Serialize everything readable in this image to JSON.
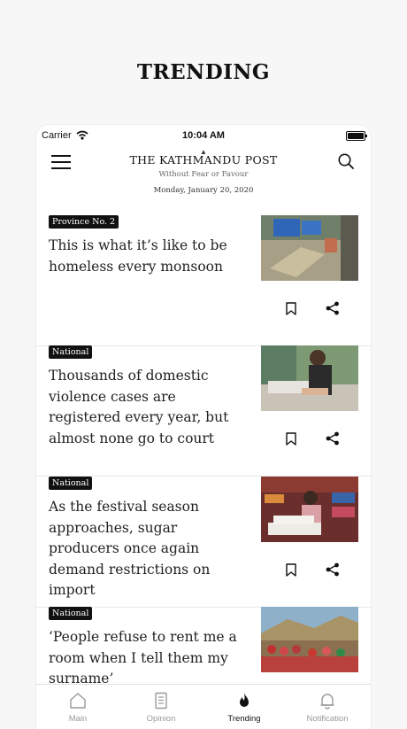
{
  "banner": {
    "title": "TRENDING"
  },
  "status_bar": {
    "carrier": "Carrier",
    "time": "10:04 AM"
  },
  "header": {
    "masthead": "THE KATHMANDU POST",
    "tagline": "Without Fear or Favour",
    "date": "Monday, January 20, 2020"
  },
  "articles": [
    {
      "category": "Province No. 2",
      "headline": "This is what it’s like to be homeless every monsoon"
    },
    {
      "category": "National",
      "headline": "Thousands of domestic violence cases are registered every year, but almost none go to court"
    },
    {
      "category": "National",
      "headline": "As the festival season approaches, sugar producers once again demand restrictions on import"
    },
    {
      "category": "National",
      "headline": "‘People refuse to rent me a room when I tell them my surname’"
    }
  ],
  "tabs": [
    {
      "label": "Main",
      "icon": "home-icon",
      "active": false
    },
    {
      "label": "Opinion",
      "icon": "document-icon",
      "active": false
    },
    {
      "label": "Trending",
      "icon": "flame-icon",
      "active": true
    },
    {
      "label": "Notification",
      "icon": "bell-icon",
      "active": false
    }
  ],
  "colors": {
    "ink": "#111111",
    "badge_bg": "#111111",
    "tab_inactive": "#999999"
  }
}
